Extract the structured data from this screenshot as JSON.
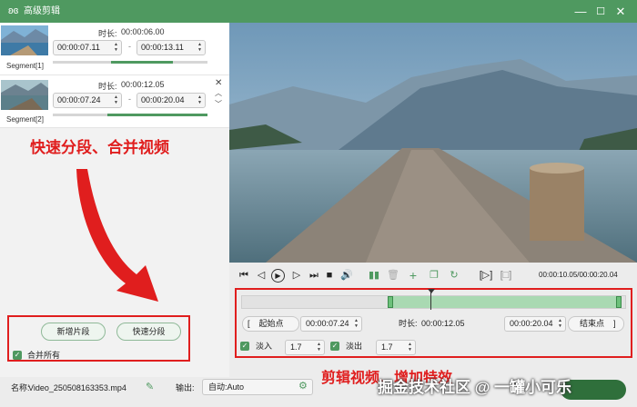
{
  "window": {
    "title": "高级剪辑",
    "min_icon": "minimize-icon",
    "max_icon": "maximize-icon",
    "close_icon": "close-icon"
  },
  "segments": [
    {
      "label": "Segment[1]",
      "duration_label": "时长:",
      "duration": "00:00:06.00",
      "start": "00:00:07.11",
      "end": "00:00:13.11",
      "dash": "-"
    },
    {
      "label": "Segment[2]",
      "duration_label": "时长:",
      "duration": "00:00:12.05",
      "start": "00:00:07.24",
      "end": "00:00:20.04",
      "dash": "-"
    }
  ],
  "left_annotation": "快速分段、合并视频",
  "segment_actions": {
    "new_segment": "新增片段",
    "quick_split": "快速分段",
    "merge_all": "合并所有"
  },
  "bottom": {
    "name_label": "名称:",
    "filename": "Video_250508163353.mp4",
    "output_label": "输出:",
    "output_value": "自动:Auto"
  },
  "playback": {
    "time": "00:00:10.05/00:00:20.04"
  },
  "edit": {
    "start_btn": "起始点",
    "start_time": "00:00:07.24",
    "duration_label": "时长:",
    "duration": "00:00:12.05",
    "end_time": "00:00:20.04",
    "end_btn": "结束点",
    "fade_in_label": "淡入",
    "fade_in": "1.7",
    "fade_out_label": "淡出",
    "fade_out": "1.7"
  },
  "right_annotation": "剪辑视频、增加特效",
  "watermark": "掘金技术社区 @ 一罐小可乐",
  "colors": {
    "accent": "#4f9960",
    "annotation": "#e01e1e"
  }
}
